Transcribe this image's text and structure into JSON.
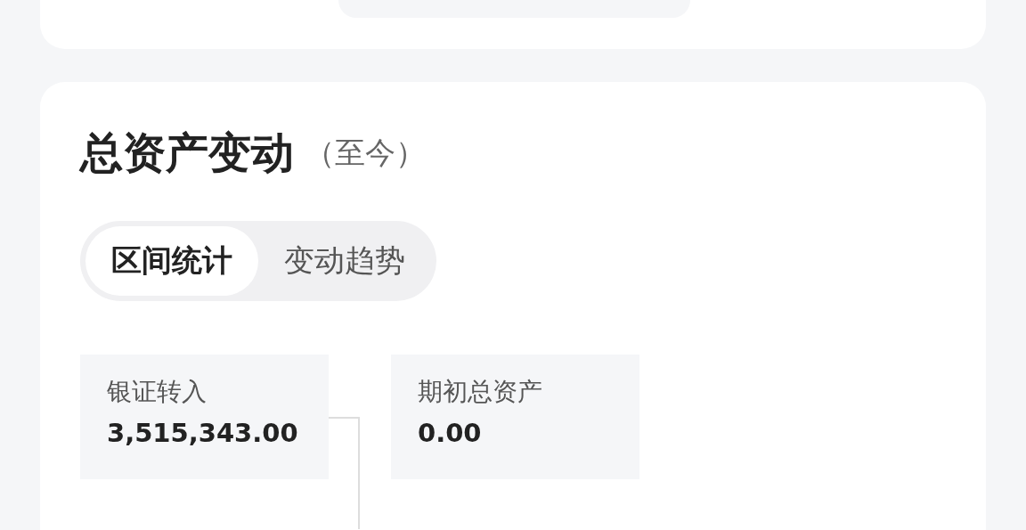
{
  "card": {
    "title": "总资产变动",
    "subtitle": "（至今）"
  },
  "tabs": [
    {
      "label": "区间统计",
      "selected": true
    },
    {
      "label": "变动趋势",
      "selected": false
    }
  ],
  "stats": [
    {
      "label": "银证转入",
      "value": "3,515,343.00"
    },
    {
      "label": "期初总资产",
      "value": "0.00"
    }
  ]
}
